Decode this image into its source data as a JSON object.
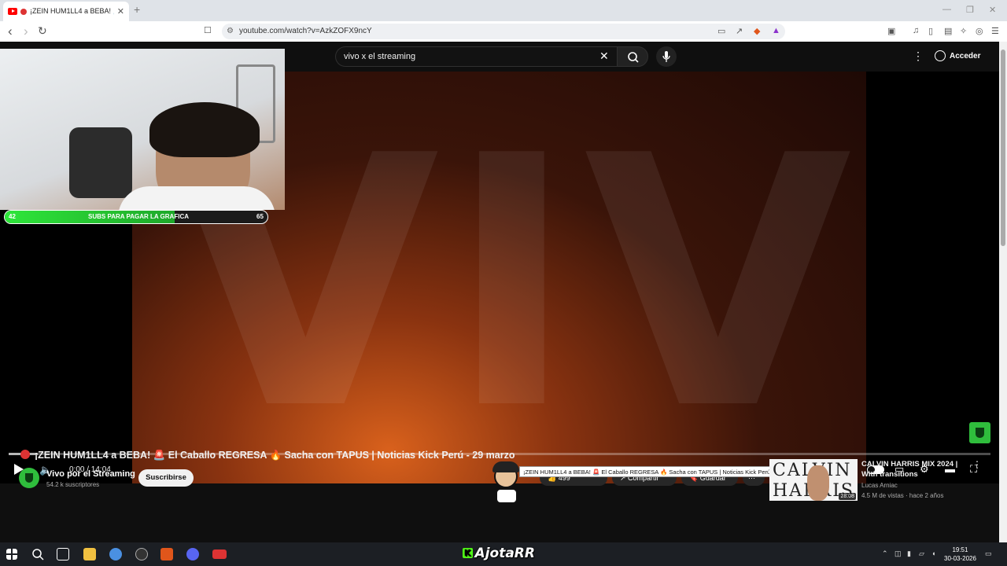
{
  "browser": {
    "tab_title": "¡ZEIN HUM1LL4 a BEBA! 🚨",
    "tab_close": "✕",
    "new_tab": "+",
    "url": "youtube.com/watch?v=AzkZOFX9ncY",
    "back": "‹",
    "forward": "›",
    "reload": "↻",
    "minimize": "—",
    "restore": "❐",
    "close": "✕"
  },
  "youtube": {
    "search_value": "vivo x el streaming",
    "clear_icon": "✕",
    "signin_label": "Acceder",
    "kebab": "⋮"
  },
  "player": {
    "overlay_text": "VIV",
    "time": "0:00 / 14:04",
    "progress_fraction": 0.03,
    "volume_icon": "🔈",
    "subs_goal": {
      "label": "SUBS PARA PAGAR LA GRAFICA",
      "current": "42",
      "target": "65"
    }
  },
  "video": {
    "title": "¡ZEIN HUM1LL4 a BEBA! 🚨 El Caballo REGRESA 🔥 Sacha con TAPUS | Noticias Kick Perú - 29 marzo",
    "channel_name": "Vivo por el Streaming",
    "channel_subs": "54.2 k suscriptores",
    "subscribe_label": "Suscribirse",
    "likes": "499",
    "share_label": "Compartir",
    "save_label": "Guardar",
    "more": "···",
    "tooltip": "¡ZEIN HUM1LL4 a BEBA! 🚨 El Caballo REGRESA 🔥 Sacha con TAPUS | Noticias Kick Perú - 29 marzo"
  },
  "recommendation": {
    "thumb_line1": "CALVIN",
    "thumb_line2": "HARRIS",
    "duration": "28:08",
    "title": "CALVIN HARRIS MIX 2024 | With transitions",
    "channel": "Lucas Arniac",
    "meta": "4.5 M de vistas · hace 2 años"
  },
  "taskbar": {
    "streamer_tag": "K",
    "streamer_name": "AjotaRR",
    "time": "19:51",
    "date": "30-03-2026"
  },
  "colors": {
    "yt_bg": "#0f0f0f",
    "kick_green": "#53fc18",
    "goal_green": "#2ee63a"
  }
}
